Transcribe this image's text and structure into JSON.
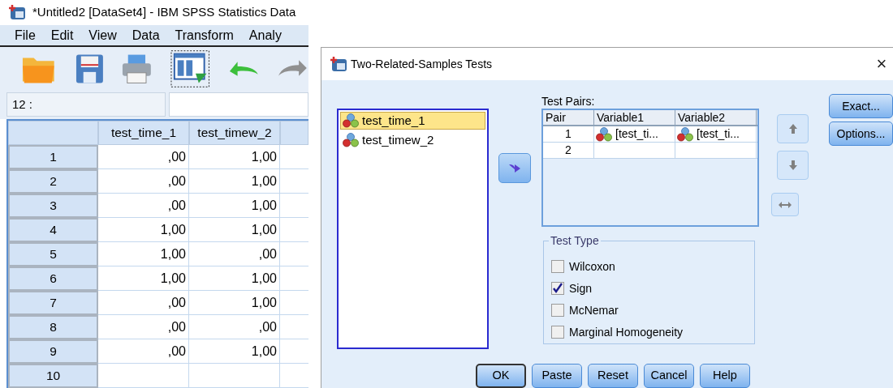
{
  "data_editor": {
    "title": "*Untitled2 [DataSet4] - IBM SPSS Statistics Data",
    "menu": [
      "File",
      "Edit",
      "View",
      "Data",
      "Transform",
      "Analy"
    ],
    "cell_ref": "12 :",
    "columns": [
      "test_time_1",
      "test_timew_2"
    ],
    "rows": [
      {
        "number": "1",
        "values": [
          ",00",
          "1,00"
        ]
      },
      {
        "number": "2",
        "values": [
          ",00",
          "1,00"
        ]
      },
      {
        "number": "3",
        "values": [
          ",00",
          "1,00"
        ]
      },
      {
        "number": "4",
        "values": [
          "1,00",
          "1,00"
        ]
      },
      {
        "number": "5",
        "values": [
          "1,00",
          ",00"
        ]
      },
      {
        "number": "6",
        "values": [
          "1,00",
          "1,00"
        ]
      },
      {
        "number": "7",
        "values": [
          ",00",
          "1,00"
        ]
      },
      {
        "number": "8",
        "values": [
          ",00",
          ",00"
        ]
      },
      {
        "number": "9",
        "values": [
          ",00",
          "1,00"
        ]
      },
      {
        "number": "10",
        "values": []
      }
    ]
  },
  "dialog": {
    "title": "Two-Related-Samples Tests",
    "close": "×",
    "variables": [
      {
        "name": "test_time_1",
        "selected": true
      },
      {
        "name": "test_timew_2",
        "selected": false
      }
    ],
    "test_pairs": {
      "label": "Test Pairs:",
      "columns": [
        "Pair",
        "Variable1",
        "Variable2"
      ],
      "rows": [
        {
          "pair": "1",
          "variable1": "[test_ti...",
          "variable2": "[test_ti..."
        },
        {
          "pair": "2"
        }
      ]
    },
    "side_buttons": [
      "Exact...",
      "Options..."
    ],
    "test_type": {
      "label": "Test Type",
      "options": [
        {
          "label": "Wilcoxon",
          "checked": false
        },
        {
          "label": "Sign",
          "checked": true
        },
        {
          "label": "McNemar",
          "checked": false
        },
        {
          "label": "Marginal Homogeneity",
          "checked": false
        }
      ]
    },
    "buttons": [
      {
        "label": "OK",
        "default": true
      },
      {
        "label": "Paste",
        "default": false
      },
      {
        "label": "Reset",
        "default": false
      },
      {
        "label": "Cancel",
        "default": false
      },
      {
        "label": "Help",
        "default": false
      }
    ]
  }
}
